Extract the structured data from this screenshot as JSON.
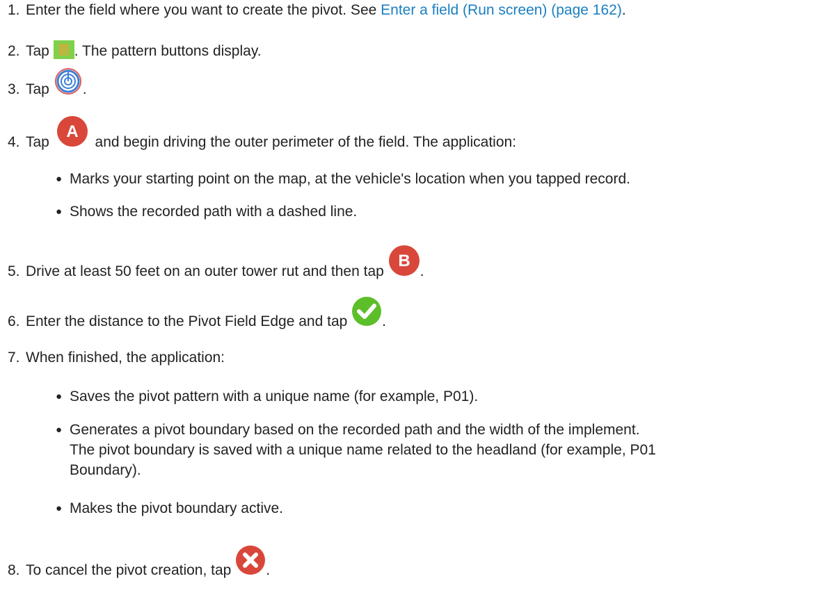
{
  "steps": [
    {
      "number": "1.",
      "before": "Enter the field where you want to create the pivot. See ",
      "link": "Enter a field (Run screen) (page 162)",
      "after": "."
    },
    {
      "number": "2.",
      "before": "Tap ",
      "icon": "pattern-icon",
      "after": ". The pattern buttons display."
    },
    {
      "number": "3.",
      "before": "Tap ",
      "icon": "pivot-target-icon",
      "after": "."
    },
    {
      "number": "4.",
      "before": "Tap ",
      "icon": "record-a-icon",
      "icon_letter": "A",
      "after": " and begin driving the outer perimeter of the field. The application:",
      "bullets": [
        "Marks your starting point on the map, at the vehicle's location when you tapped record.",
        "Shows the recorded path with a dashed line."
      ]
    },
    {
      "number": "5.",
      "before": "Drive at least 50 feet on an outer tower rut and then tap ",
      "icon": "record-b-icon",
      "icon_letter": "B",
      "after": "."
    },
    {
      "number": "6.",
      "before": "Enter the distance to the Pivot Field Edge and tap ",
      "icon": "accept-check-icon",
      "after": "."
    },
    {
      "number": "7.",
      "before": "When finished, the application:",
      "bullets": [
        "Saves the pivot pattern with a unique name (for example, P01).",
        "Generates a pivot boundary based on the recorded path and the width of the implement.",
        "The pivot boundary is saved with a unique name related to the headland (for example, P01",
        "Boundary).",
        "Makes the pivot boundary active."
      ]
    },
    {
      "number": "8.",
      "before": "To cancel the pivot creation, tap ",
      "icon": "cancel-x-icon",
      "after": "."
    }
  ],
  "colors": {
    "text": "#222222",
    "link": "#1a7fc1",
    "icon_red": "#d9473b",
    "icon_green": "#5cbf2a",
    "icon_pattern_bg": "#7fd14a",
    "icon_pattern_fg": "#e8a23a",
    "icon_target_blue": "#3b7fd6",
    "icon_target_red": "#e05a5a"
  }
}
